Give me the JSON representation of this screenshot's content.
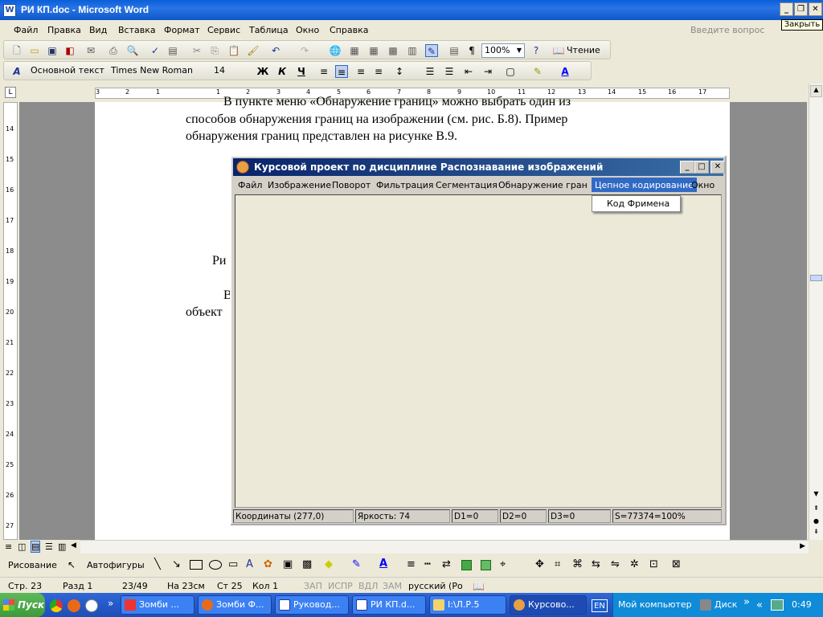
{
  "window": {
    "title": "РИ КП.doc - Microsoft Word",
    "icon": "W"
  },
  "tooltip": "Закрыть",
  "menu": [
    "Файл",
    "Правка",
    "Вид",
    "Вставка",
    "Формат",
    "Сервис",
    "Таблица",
    "Окно",
    "Справка"
  ],
  "ask_placeholder": "Введите вопрос",
  "toolbar1": {
    "zoom": "100%",
    "reading": "Чтение"
  },
  "toolbar2": {
    "style": "Основной текст",
    "font": "Times New Roman",
    "size": "14"
  },
  "ruler_numbers": [
    "3",
    "2",
    "1",
    "1",
    "2",
    "3",
    "4",
    "5",
    "6",
    "7",
    "8",
    "9",
    "10",
    "11",
    "12",
    "13",
    "14",
    "15",
    "16",
    "17"
  ],
  "vruler_numbers": [
    "14",
    "15",
    "16",
    "17",
    "18",
    "19",
    "20",
    "21",
    "22",
    "23",
    "24",
    "25",
    "26",
    "27"
  ],
  "doc": {
    "line1": "В пункте меню «Обнаружение границ» можно выбрать один из",
    "line2": "способов обнаружения границ на изображении (см. рис. Б.8). Пример",
    "line3": "обнаружения границ представлен на рисунке В.9.",
    "frag1": "Ри",
    "frag2": "В",
    "frag3": "объект"
  },
  "app": {
    "title": "Курсовой проект по дисциплине Распознавание изображений",
    "menu": [
      "Файл",
      "Изображение",
      "Поворот",
      "Фильтрация",
      "Сегментация",
      "Обнаружение границ",
      "Цепное кодирование",
      "Окно"
    ],
    "dropdown_item": "Код Фримена",
    "status": [
      "Координаты (277,0)",
      "Яркость: 74",
      "D1=0",
      "D2=0",
      "D3=0",
      "S=77374=100%"
    ]
  },
  "drawbar": {
    "draw": "Рисование",
    "autoshapes": "Автофигуры"
  },
  "statusbar": {
    "page": "Стр. 23",
    "section": "Разд 1",
    "pages": "23/49",
    "at": "На 23см",
    "line": "Ст 25",
    "col": "Кол 1",
    "rec": "ЗАП",
    "trk": "ИСПР",
    "ext": "ВДЛ",
    "ovr": "ЗАМ",
    "lang": "русский (Ро"
  },
  "taskbar": {
    "start": "Пуск",
    "tasks": [
      "Зомби ...",
      "Зомби Ф...",
      "Руковод...",
      "РИ КП.d...",
      "I:\\Л.Р.5",
      "Курсово..."
    ],
    "lang": "EN",
    "mycomp": "Мой компьютер",
    "disk": "Диск",
    "time": "0:49"
  },
  "colors": {
    "xp_blue": "#0a5fd8",
    "win2k_title": "#0a246a",
    "selected_menu": "#316ac5"
  }
}
